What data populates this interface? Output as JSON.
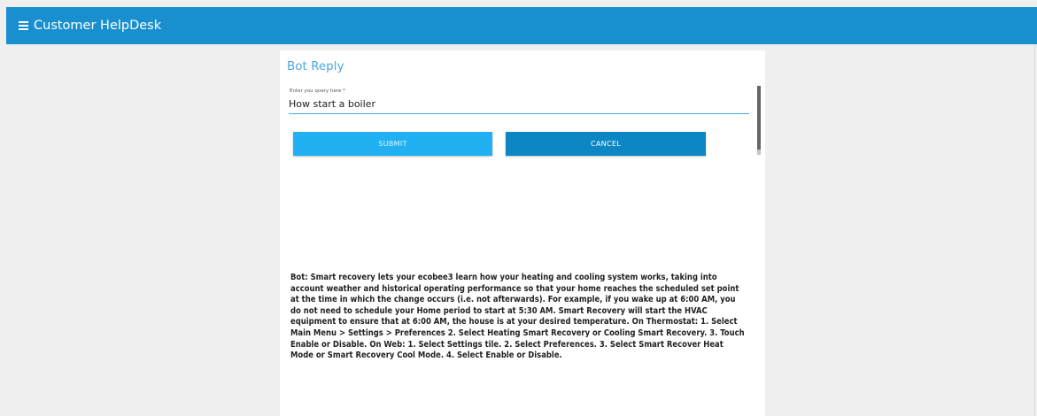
{
  "app": {
    "title": "Customer HelpDesk",
    "menu_icon": "hamburger-menu-icon"
  },
  "card": {
    "title": "Bot Reply",
    "query": {
      "label": "Enter you query here *",
      "value": "How start a boiler"
    },
    "buttons": {
      "submit_label": "SUBMIT",
      "cancel_label": "CANCEL"
    },
    "bot_reply": "Bot: Smart recovery lets your ecobee3 learn how your heating and cooling system works, taking into account weather and historical operating performance so that your home reaches the scheduled set point at the time in which the change occurs (i.e. not afterwards). For example, if you wake up at 6:00 AM, you do not need to schedule your Home period to start at 5:30 AM. Smart Recovery will start the HVAC equipment to ensure that at 6:00 AM, the house is at your desired temperature. On Thermostat: 1. Select Main Menu > Settings > Preferences 2. Select Heating Smart Recovery or Cooling Smart Recovery. 3. Touch Enable or Disable. On Web: 1. Select Settings tile. 2. Select Preferences. 3. Select Smart Recover Heat Mode or Smart Recovery Cool Mode. 4. Select Enable or Disable."
  },
  "colors": {
    "header": "#1a8fcf",
    "accent": "#4da6dc",
    "submit_button": "#21b1f2",
    "cancel_button": "#0d86c4",
    "page_background": "#efefef"
  }
}
